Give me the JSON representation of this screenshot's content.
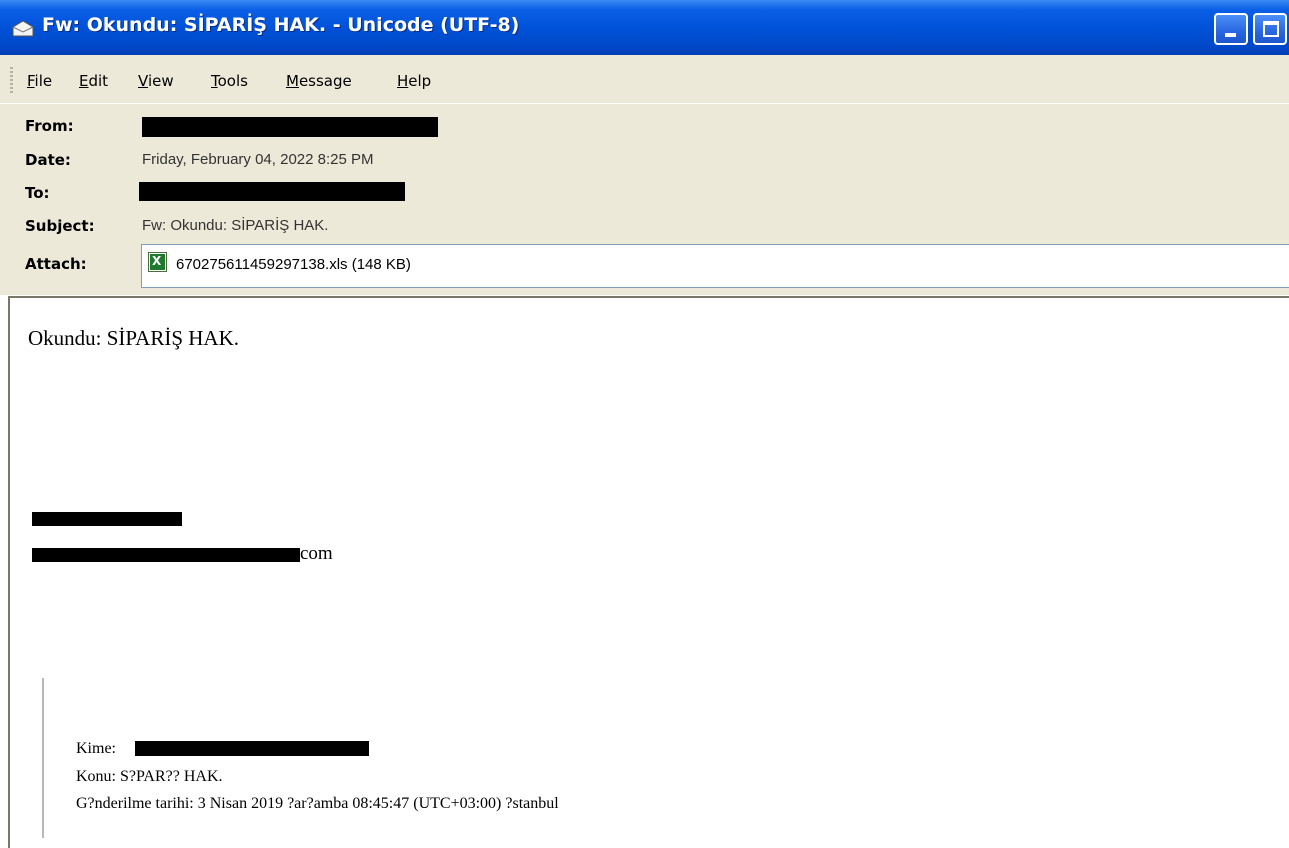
{
  "window": {
    "title": "Fw: Okundu: SİPARİŞ HAK. - Unicode (UTF-8)",
    "controls": [
      "minimize",
      "maximize"
    ]
  },
  "menu": [
    "File",
    "Edit",
    "View",
    "Tools",
    "Message",
    "Help"
  ],
  "header": {
    "from_label": "From:",
    "date_label": "Date:",
    "date_value": "Friday, February 04, 2022 8:25 PM",
    "to_label": "To:",
    "subject_label": "Subject:",
    "subject_value": "Fw: Okundu: SİPARİŞ HAK.",
    "attach_label": "Attach:",
    "attachment": {
      "name": "670275611459297138.xls (148 KB)",
      "icon": "excel-file-icon"
    }
  },
  "body": {
    "heading": "Okundu: SİPARİŞ HAK.",
    "signature_email_suffix": "com",
    "quote": {
      "kime_label": "Kime:",
      "konu": "Konu: S?PAR?? HAK.",
      "gonderilme": "G?nderilme tarihi: 3 Nisan 2019 ?ar?amba 08:45:47 (UTC+03:00) ?stanbul"
    }
  },
  "colors": {
    "titlebar": "#0052d8",
    "chrome": "#ece9d8",
    "redaction": "#000000"
  }
}
